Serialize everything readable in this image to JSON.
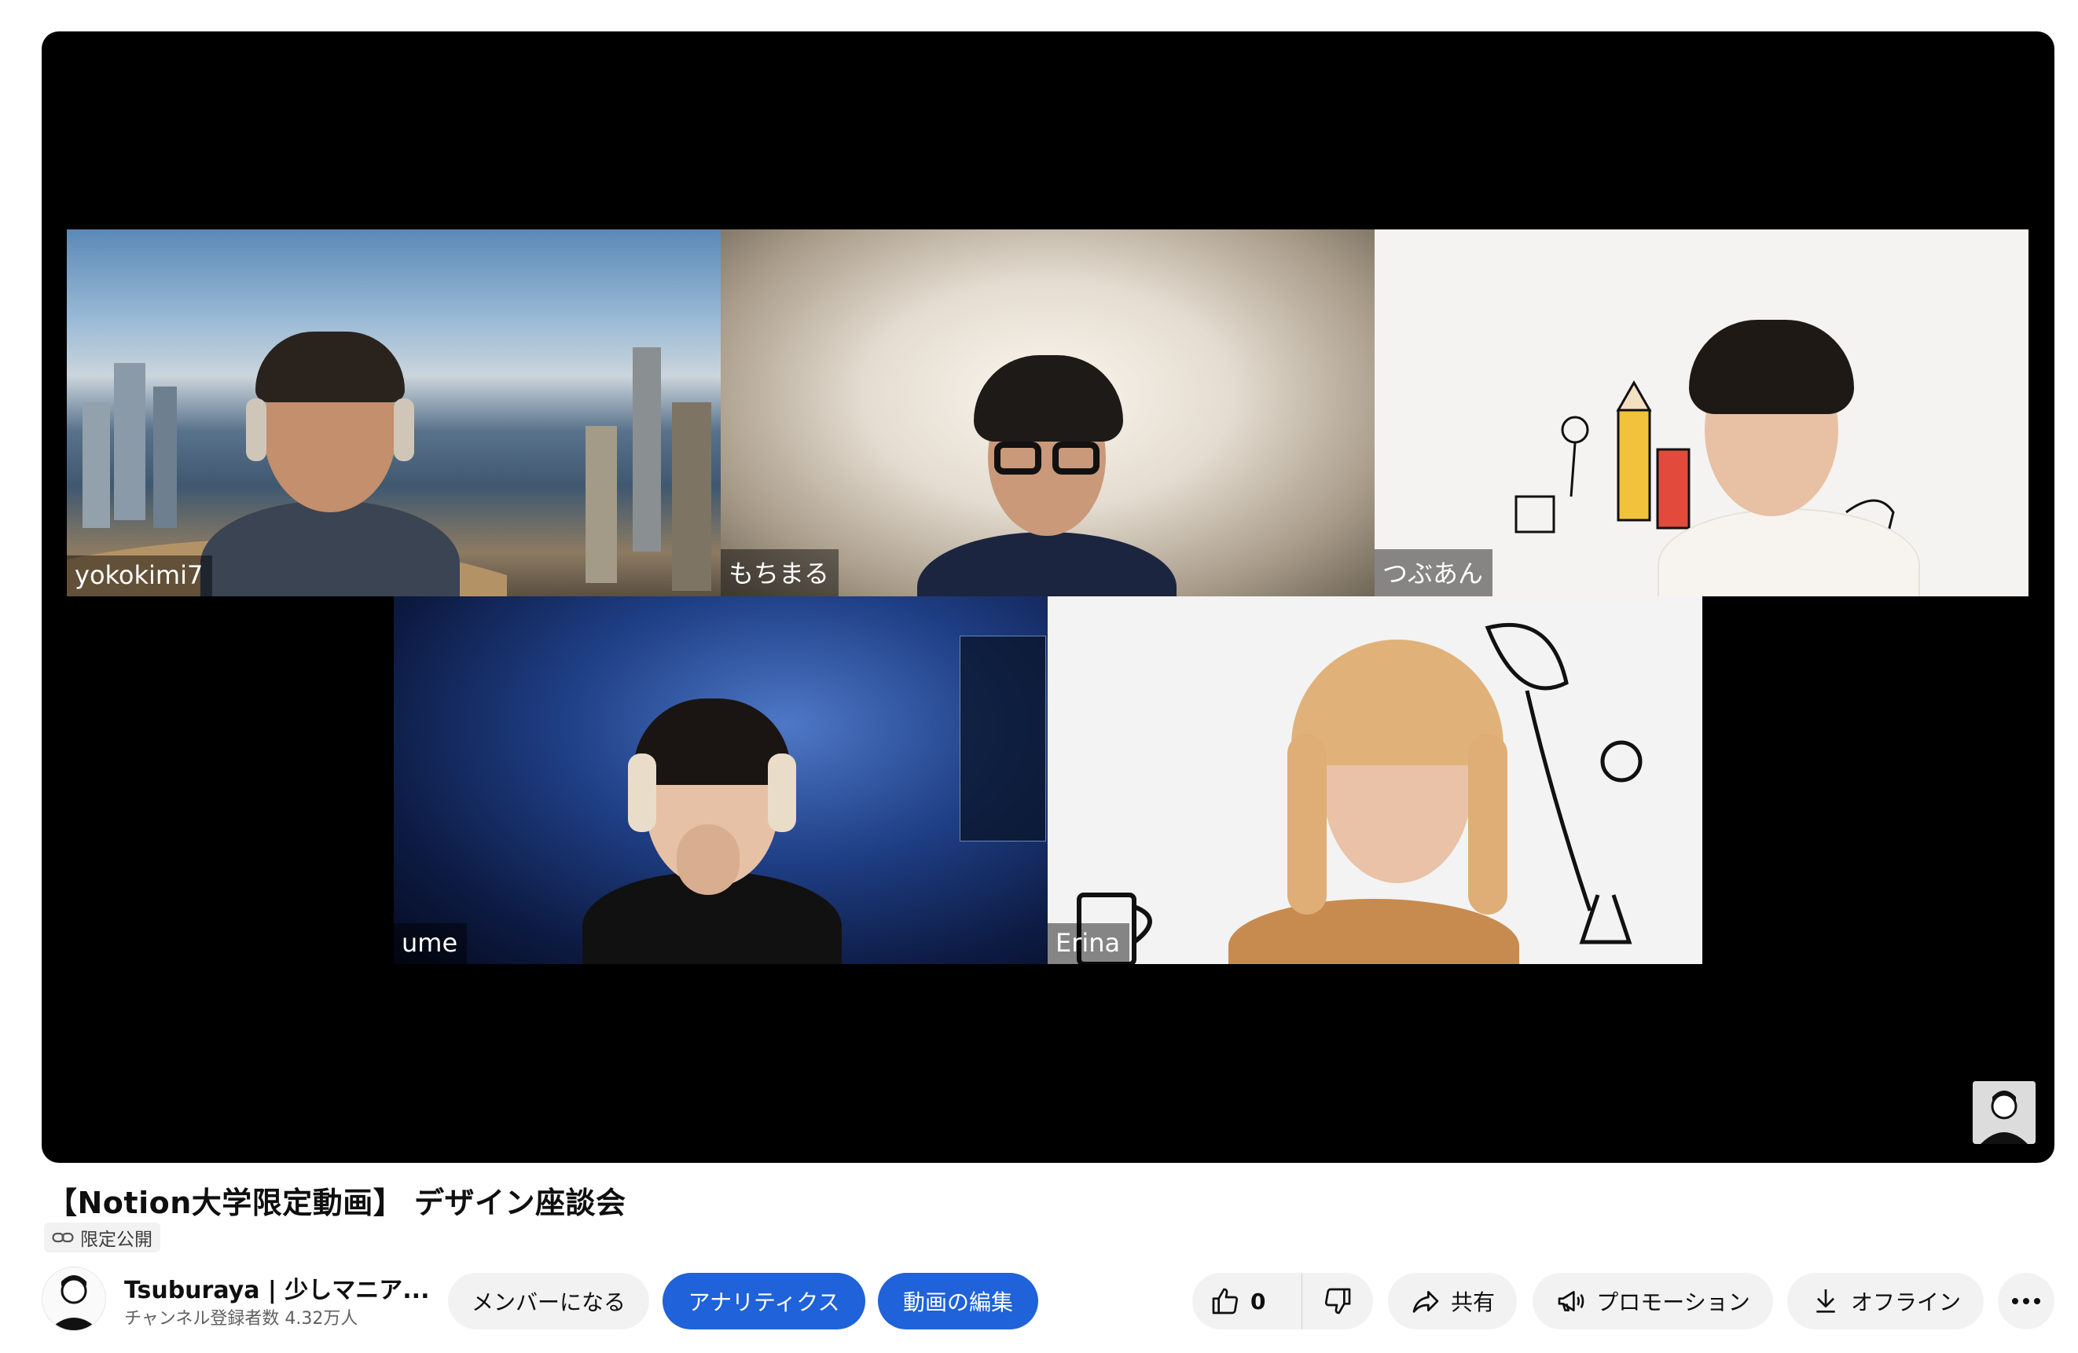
{
  "video": {
    "participants": [
      {
        "name": "yokokimi7"
      },
      {
        "name": "もちまる"
      },
      {
        "name": "つぶあん"
      },
      {
        "name": "ume"
      },
      {
        "name": "Erina"
      }
    ]
  },
  "title": "【Notion大学限定動画】 デザイン座談会",
  "privacy_label": "限定公開",
  "channel": {
    "name": "Tsuburaya | 少しマニア...",
    "subscribers": "チャンネル登録者数 4.32万人"
  },
  "actions": {
    "member": "メンバーになる",
    "analytics": "アナリティクス",
    "edit": "動画の編集",
    "like_count": "0",
    "share": "共有",
    "promotion": "プロモーション",
    "offline": "オフライン"
  },
  "colors": {
    "accent_blue": "#1f62d9",
    "pill_grey": "#f2f2f2"
  },
  "icons": [
    "link-icon",
    "thumbs-up-icon",
    "thumbs-down-icon",
    "share-icon",
    "megaphone-icon",
    "download-icon",
    "more-icon"
  ]
}
